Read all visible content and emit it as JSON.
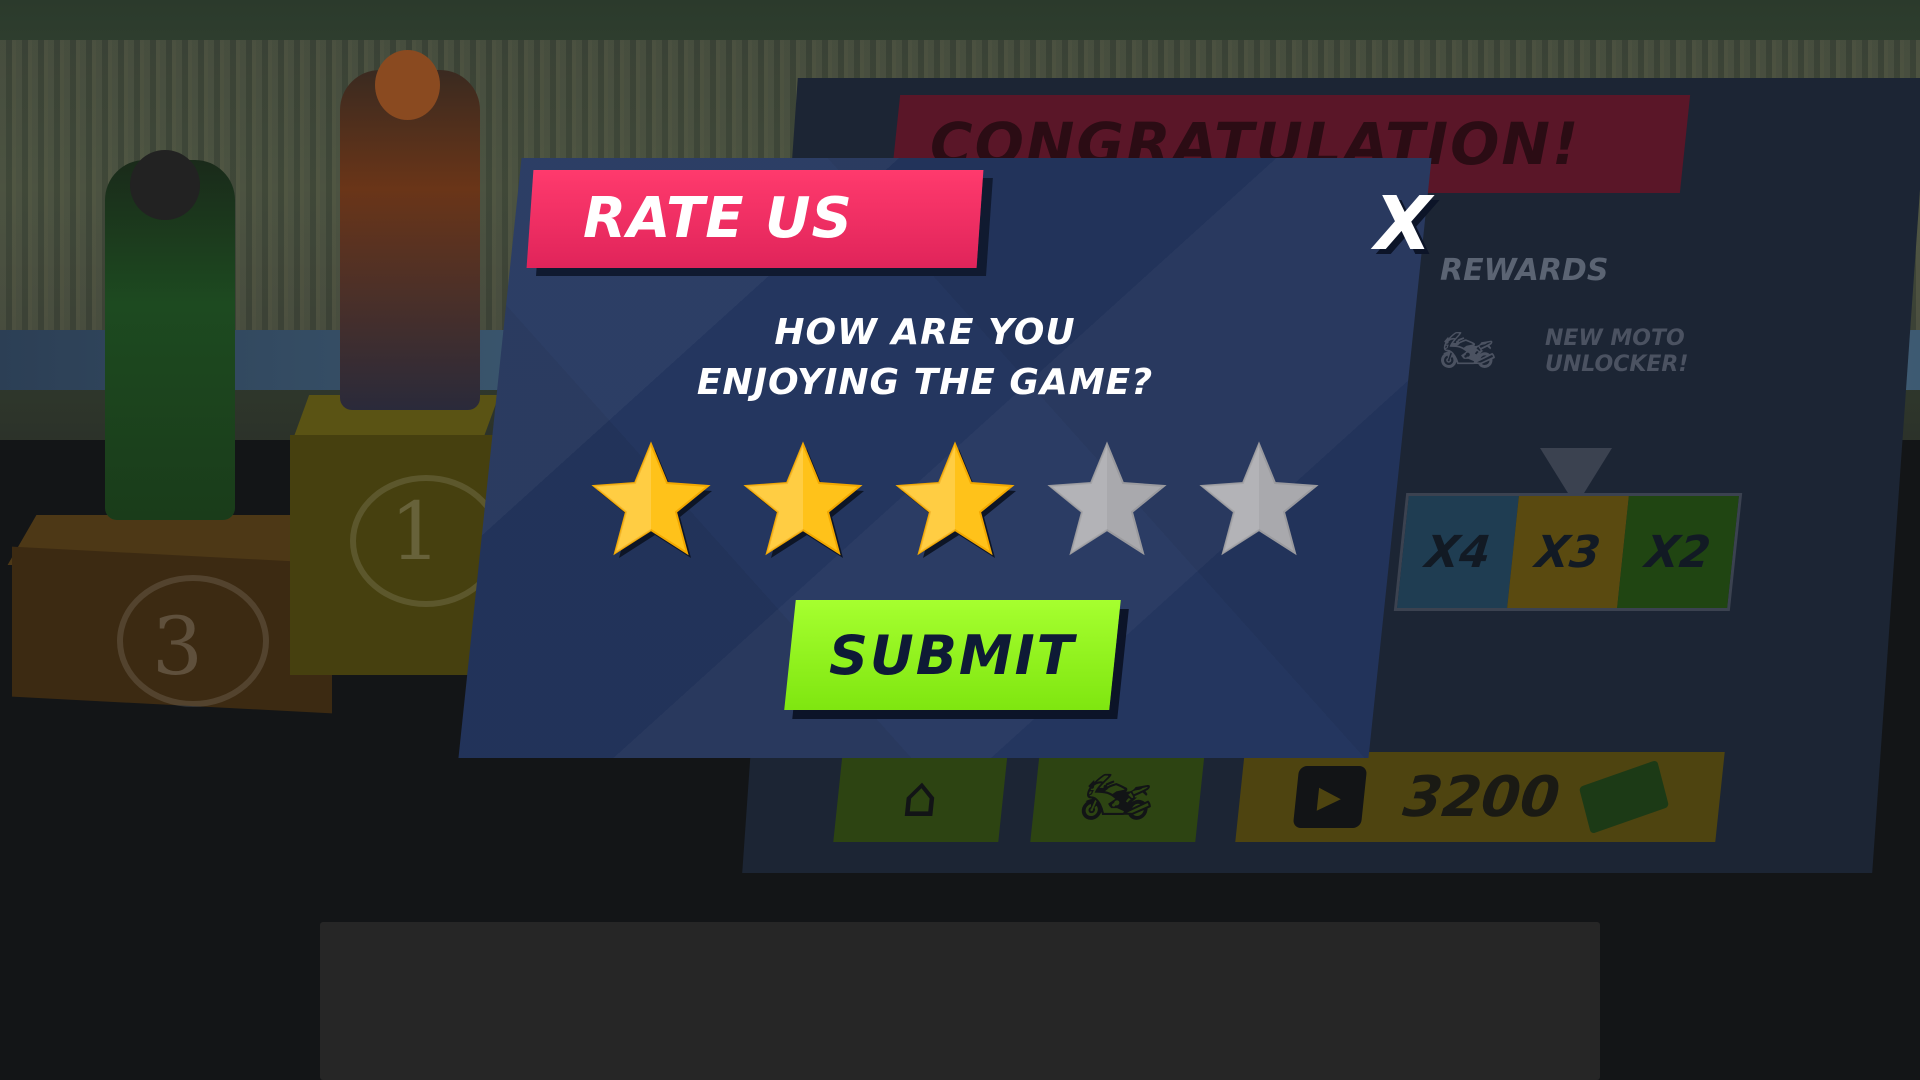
{
  "background": {
    "congrats_title": "CONGRATULATION!",
    "rewards_label": "REWARDS",
    "new_moto_label": "NEW MOTO UNLOCKER!",
    "multipliers": [
      "X4",
      "X3",
      "X2"
    ],
    "reward_amount": "3200",
    "podium_places": [
      "3",
      "1"
    ],
    "icons": {
      "home": "home-icon",
      "moto": "motorcycle-icon",
      "video": "video-ad-icon",
      "cash": "cash-icon"
    }
  },
  "dialog": {
    "title": "RATE US",
    "close_label": "X",
    "question_line1": "HOW ARE YOU",
    "question_line2": "ENJOYING THE GAME?",
    "rating": 3,
    "max_rating": 5,
    "submit_label": "SUBMIT",
    "colors": {
      "panel": "#24365f",
      "title_bar": "#ff3a6d",
      "submit": "#93f520",
      "star_filled": "#ffc21a",
      "star_empty": "#a9a9ad"
    }
  }
}
